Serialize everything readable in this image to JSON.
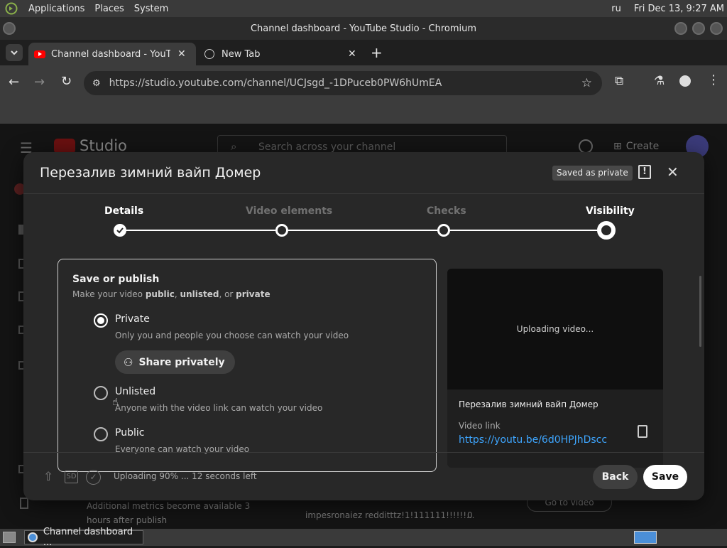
{
  "system_panel": {
    "menus": [
      "Applications",
      "Places",
      "System"
    ],
    "keyboard_layout": "ru",
    "clock": "Fri Dec 13,  9:27 AM"
  },
  "window": {
    "title": "Channel dashboard - YouTube Studio - Chromium"
  },
  "tabs": [
    {
      "label": "Channel dashboard - YouTub",
      "active": true
    },
    {
      "label": "New Tab",
      "active": false
    }
  ],
  "omnibox": {
    "url": "https://studio.youtube.com/channel/UCJsgd_-1DPuceb0PW6hUmEA"
  },
  "studio_header": {
    "logo_text": "Studio",
    "search_placeholder": "Search across your channel",
    "create_label": "Create"
  },
  "background_page": {
    "left_text_line1": "Additional metrics become available 3",
    "left_text_line2": "hours after publish",
    "comment_text": "impesronaiez redditttz!1!111111!!!!!!...",
    "comment_count": "0",
    "right_button": "Go to video"
  },
  "modal": {
    "title": "Перезалив зимний вайп Домер",
    "saved_chip": "Saved as private",
    "steps": [
      {
        "label": "Details",
        "state": "done"
      },
      {
        "label": "Video elements",
        "state": "pending"
      },
      {
        "label": "Checks",
        "state": "pending"
      },
      {
        "label": "Visibility",
        "state": "current"
      }
    ],
    "publish": {
      "heading": "Save or publish",
      "sub_prefix": "Make your video ",
      "sub_public": "public",
      "sub_sep1": ", ",
      "sub_unlisted": "unlisted",
      "sub_sep2": ", or ",
      "sub_private": "private",
      "options": [
        {
          "label": "Private",
          "desc": "Only you and people you choose can watch your video",
          "selected": true
        },
        {
          "label": "Unlisted",
          "desc": "Anyone with the video link can watch your video",
          "selected": false
        },
        {
          "label": "Public",
          "desc": "Everyone can watch your video",
          "selected": false
        }
      ],
      "share_label": "Share privately"
    },
    "preview": {
      "status": "Uploading video...",
      "video_title": "Перезалив зимний вайп Домер",
      "link_label": "Video link",
      "link_url": "https://youtu.be/6d0HPJhDscc"
    },
    "footer": {
      "sd_badge": "SD",
      "upload_status": "Uploading 90% ... 12 seconds left",
      "back_label": "Back",
      "save_label": "Save"
    }
  },
  "taskbar": {
    "item_label": "Channel dashboard ..."
  },
  "colors": {
    "link": "#3ea6ff",
    "youtube_red": "#ff0000",
    "modal_bg": "#282828"
  }
}
